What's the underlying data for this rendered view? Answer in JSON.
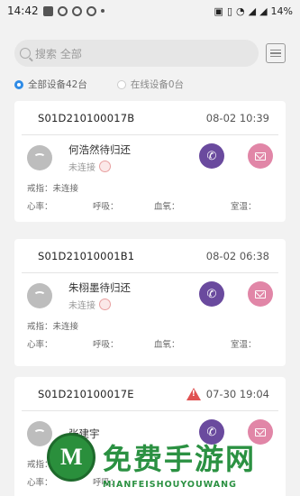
{
  "status_bar": {
    "time": "14:42",
    "battery": "14%"
  },
  "search": {
    "placeholder": "搜索 全部"
  },
  "filters": {
    "all_label": "全部设备42台",
    "online_label": "在线设备0台"
  },
  "labels": {
    "rehab": "戒指：",
    "heart_rate": "心率：",
    "breath": "呼吸：",
    "blood_oxygen": "血氧：",
    "room_temp": "室温："
  },
  "devices": [
    {
      "serial": "S01D210100017B",
      "time": "08-02 10:39",
      "name": "何浩然待归还",
      "status": "未连接",
      "rehab_value": "未连接",
      "warning": false
    },
    {
      "serial": "S01D21010001B1",
      "time": "08-02 06:38",
      "name": "朱栩墨待归还",
      "status": "未连接",
      "rehab_value": "未连接",
      "warning": false
    },
    {
      "serial": "S01D210100017E",
      "time": "07-30 19:04",
      "name": "张建宇",
      "status": "",
      "rehab_value": "",
      "warning": true
    }
  ],
  "watermark": {
    "title": "免费手游网",
    "subtitle": "MIANFEISHOUYOUWANG",
    "logo_letter": "M"
  }
}
